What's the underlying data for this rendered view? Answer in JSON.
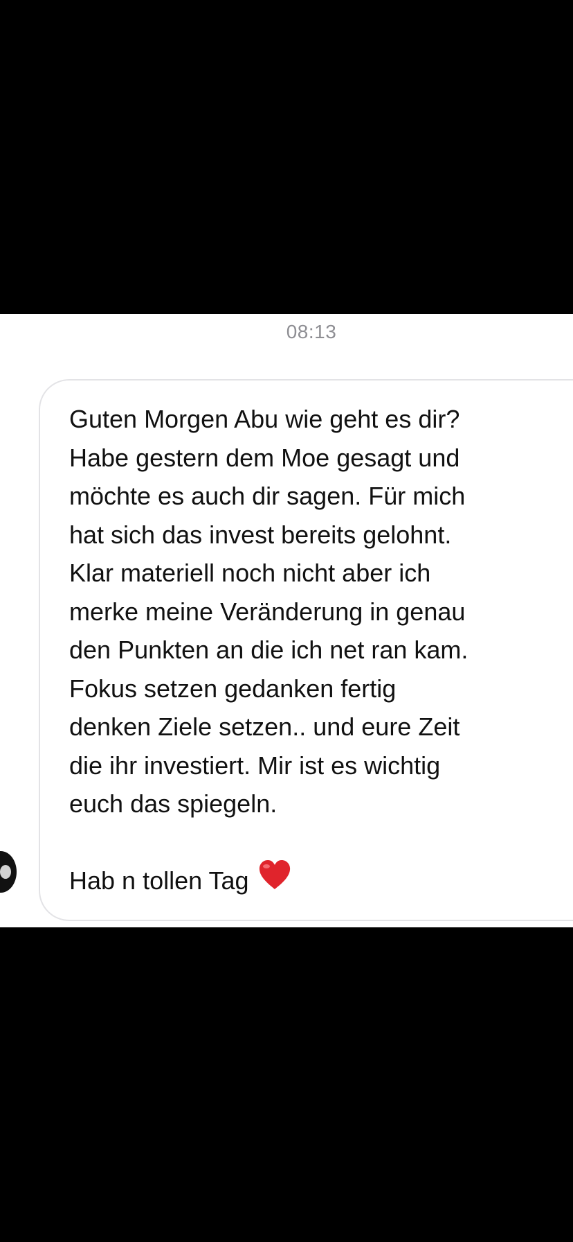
{
  "chat": {
    "timestamp": "08:13",
    "message": {
      "lines": [
        "Guten Morgen Abu wie geht es dir?",
        "Habe gestern dem Moe gesagt und",
        "möchte es auch dir sagen. Für mich",
        "hat sich das invest bereits gelohnt.",
        "Klar materiell noch nicht aber ich",
        "merke meine Veränderung in genau",
        "den Punkten an die ich net ran kam.",
        "Fokus setzen gedanken fertig",
        "denken Ziele setzen.. und eure Zeit",
        "die ihr investiert. Mir ist es wichtig",
        "euch das spiegeln."
      ],
      "closing": "Hab n tollen Tag",
      "emoji_icon": "red-heart-icon"
    }
  },
  "colors": {
    "background_outer": "#000000",
    "chat_background": "#ffffff",
    "bubble_border": "#e3e3e6",
    "timestamp": "#8e8e93",
    "text": "#111111",
    "heart": "#e0242c"
  }
}
